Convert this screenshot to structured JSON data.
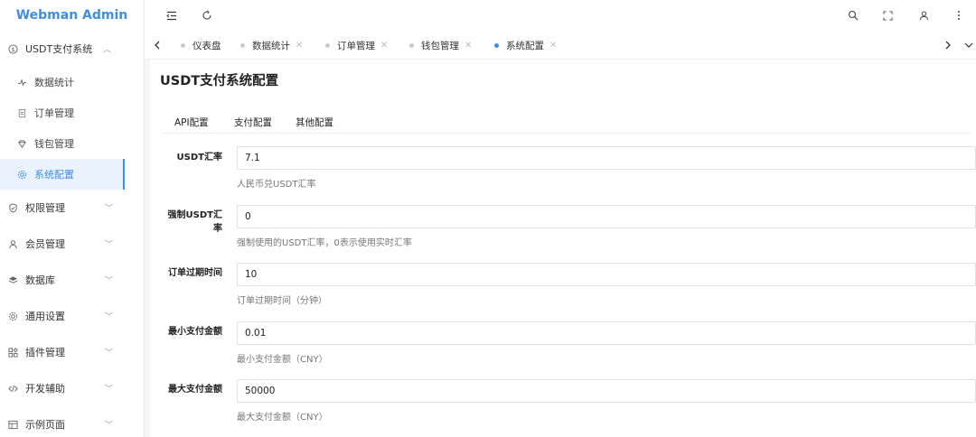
{
  "app": {
    "title": "Webman Admin",
    "brand_color": "#3f8ee0"
  },
  "sidebar": {
    "groups": [
      {
        "label": "USDT支付系统",
        "icon": "dollar-circle-icon",
        "expanded": true,
        "items": [
          {
            "label": "数据统计",
            "icon": "activity-icon"
          },
          {
            "label": "订单管理",
            "icon": "file-icon"
          },
          {
            "label": "钱包管理",
            "icon": "diamond-icon"
          },
          {
            "label": "系统配置",
            "icon": "gear-icon",
            "active": true
          }
        ]
      },
      {
        "label": "权限管理",
        "icon": "shield-icon"
      },
      {
        "label": "会员管理",
        "icon": "user-icon"
      },
      {
        "label": "数据库",
        "icon": "database-icon"
      },
      {
        "label": "通用设置",
        "icon": "settings-icon"
      },
      {
        "label": "插件管理",
        "icon": "apps-icon"
      },
      {
        "label": "开发辅助",
        "icon": "code-icon"
      },
      {
        "label": "示例页面",
        "icon": "layout-icon"
      }
    ]
  },
  "header": {
    "icons": [
      "menu-fold-icon",
      "refresh-icon",
      "search-icon",
      "fullscreen-icon",
      "user-icon",
      "more-icon"
    ]
  },
  "tabs": [
    {
      "label": "仪表盘",
      "closable": false
    },
    {
      "label": "数据统计",
      "closable": true
    },
    {
      "label": "订单管理",
      "closable": true
    },
    {
      "label": "钱包管理",
      "closable": true
    },
    {
      "label": "系统配置",
      "closable": true,
      "active": true
    }
  ],
  "page": {
    "title": "USDT支付系统配置",
    "inner_tabs": [
      "API配置",
      "支付配置",
      "其他配置"
    ],
    "fields": [
      {
        "label": "USDT汇率",
        "value": "7.1",
        "help": "人民币兑USDT汇率"
      },
      {
        "label": "强制USDT汇率",
        "value": "0",
        "help": "强制使用的USDT汇率，0表示使用实时汇率"
      },
      {
        "label": "订单过期时间",
        "value": "10",
        "help": "订单过期时间（分钟）"
      },
      {
        "label": "最小支付金额",
        "value": "0.01",
        "help": "最小支付金额（CNY）"
      },
      {
        "label": "最大支付金额",
        "value": "50000",
        "help": "最大支付金额（CNY）"
      }
    ]
  }
}
